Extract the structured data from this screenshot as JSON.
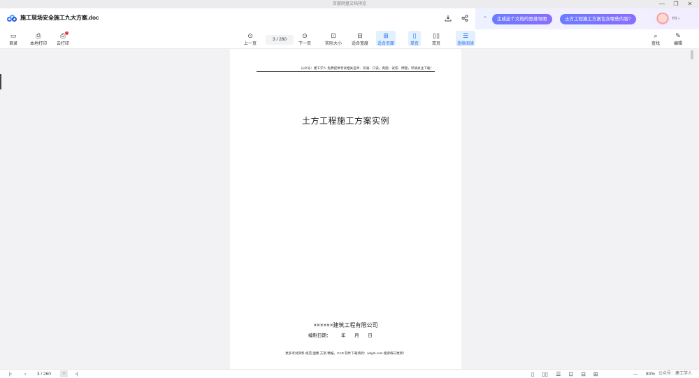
{
  "window": {
    "title": "百度网盘文档预览",
    "controls": [
      "—",
      "❐",
      "✕"
    ]
  },
  "header": {
    "doc_name": "施工现场安全施工九大方案.doc",
    "icons": [
      "download-icon",
      "share-icon"
    ]
  },
  "ai_panel": {
    "close": "×",
    "suggestions": [
      "生成这个文档的思维导图",
      "土方工程施工方案包含哪些内容?"
    ],
    "greeting": "Hi ›"
  },
  "toolbar": {
    "catalog": "目录",
    "local_print": "本地打印",
    "cloud_print": "云打印",
    "prev_page": "上一页",
    "page_indicator": "3  /  260",
    "next_page": "下一页",
    "actual_size": "实际大小",
    "fit_width": "适合宽度",
    "fit_page": "适合页面",
    "single_page": "单页",
    "double_page": "双页",
    "continuous": "连续阅读",
    "search": "查找",
    "edit": "编辑"
  },
  "document": {
    "header_text": "公众号：建工学人 免费提供考试相关名师、背诵、口诀、真题、试卷、押题，尽请关注下载！",
    "title": "土方工程施工方案实例",
    "company": "××××××建筑工程有限公司",
    "date_line": "编制日期：        年       月       日",
    "footer_text": "更多考试资料 规范 图集 方案 精编，CAD 软件下载请到：wdgrk.com 搜索每日更新！"
  },
  "statusbar": {
    "first": "|‹",
    "prev": "‹",
    "page_indicator": "3  /  260",
    "next": "›",
    "last": "›|",
    "zoom_minus": "—",
    "zoom": "80%",
    "zoom_plus": "+",
    "watermark": "公众号：建工学人"
  },
  "colors": {
    "accent": "#1f6fe5",
    "ai_chip": "#7a74ff"
  }
}
